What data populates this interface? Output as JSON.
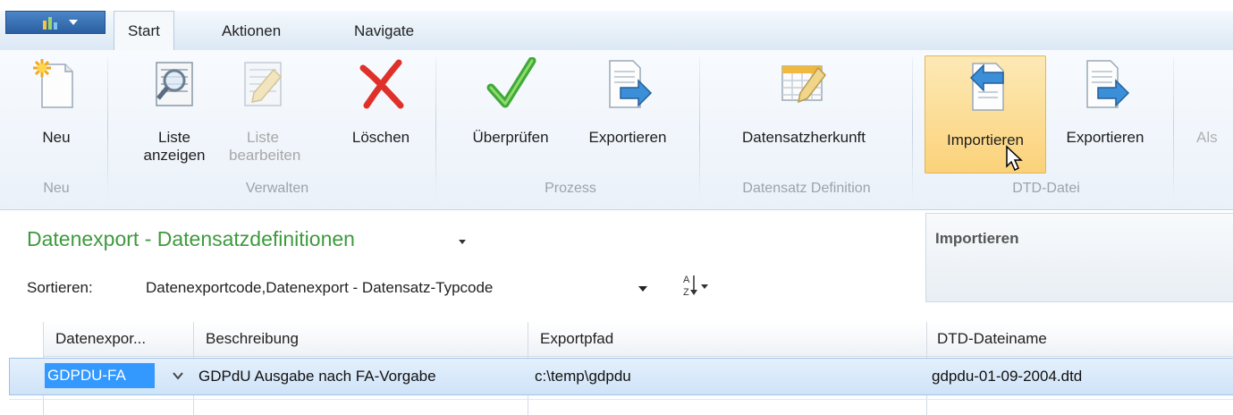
{
  "tabs": [
    {
      "label": "Start"
    },
    {
      "label": "Aktionen"
    },
    {
      "label": "Navigate"
    }
  ],
  "ribbon": {
    "groups": [
      {
        "label": "Neu",
        "buttons": [
          {
            "label": "Neu",
            "icon": "new-document-icon"
          }
        ]
      },
      {
        "label": "Verwalten",
        "buttons": [
          {
            "label": "Liste anzeigen",
            "icon": "view-list-icon"
          },
          {
            "label": "Liste bearbeiten",
            "icon": "edit-list-icon",
            "disabled": true
          },
          {
            "label": "Löschen",
            "icon": "delete-x-icon"
          }
        ]
      },
      {
        "label": "Prozess",
        "buttons": [
          {
            "label": "Überprüfen",
            "icon": "checkmark-icon"
          },
          {
            "label": "Exportieren",
            "icon": "export-icon"
          }
        ]
      },
      {
        "label": "Datensatz Definition",
        "buttons": [
          {
            "label": "Datensatzherkunft",
            "icon": "record-source-icon"
          }
        ]
      },
      {
        "label": "DTD-Datei",
        "buttons": [
          {
            "label": "Importieren",
            "icon": "import-icon",
            "hover": true
          },
          {
            "label": "Exportieren",
            "icon": "export-icon"
          }
        ]
      }
    ],
    "truncated_label": "Als"
  },
  "page": {
    "title": "Datenexport - Datensatzdefinitionen",
    "sort_label": "Sortieren:",
    "sort_value": "Datenexportcode,Datenexport - Datensatz-Typcode"
  },
  "factbox": {
    "title": "Importieren"
  },
  "grid": {
    "columns": [
      "Datenexpor...",
      "Beschreibung",
      "Exportpfad",
      "DTD-Dateiname"
    ],
    "rows": [
      {
        "code": "GDPDU-FA",
        "description": "GDPdU Ausgabe nach FA-Vorgabe",
        "path": "c:\\temp\\gdpdu",
        "dtd": "gdpdu-01-09-2004.dtd"
      }
    ]
  },
  "colors": {
    "accent": "#3399ff",
    "title_green": "#3e9a3e",
    "hover": "#fbd27a"
  }
}
